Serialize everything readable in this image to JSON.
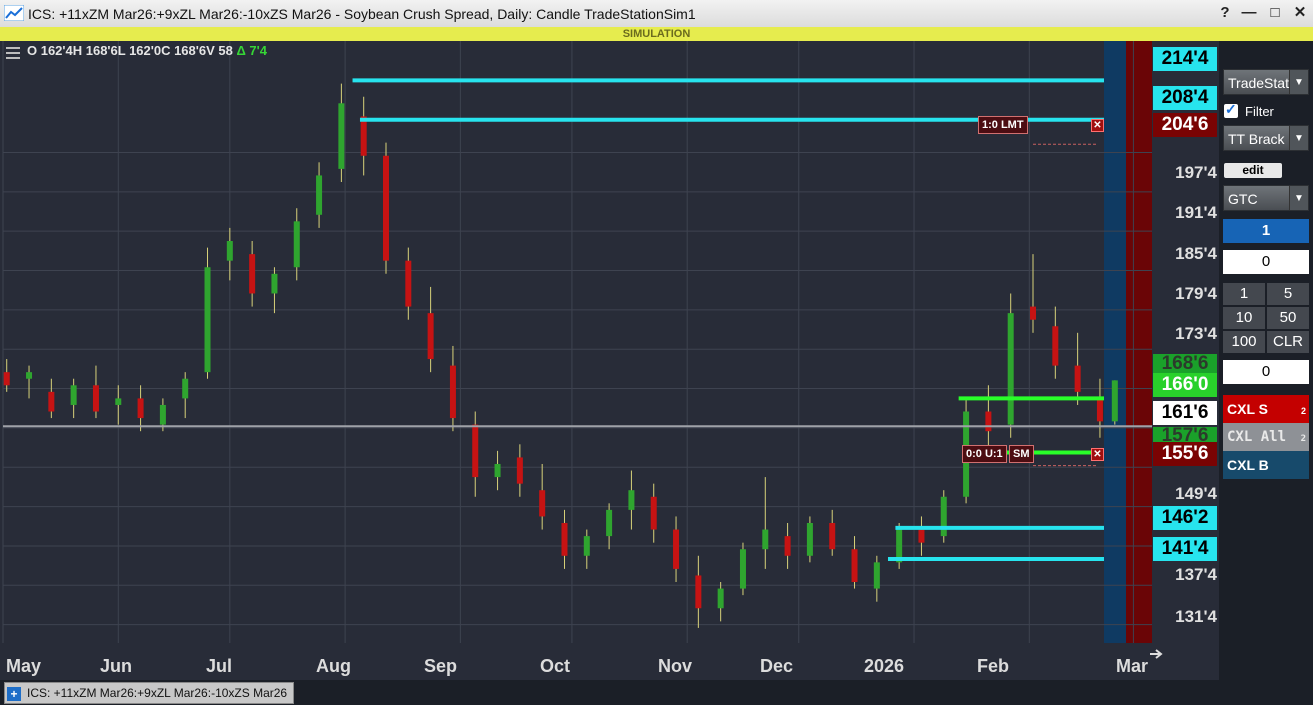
{
  "window": {
    "title": "ICS: +11xZM Mar26:+9xZL Mar26:-10xZS Mar26 - Soybean Crush Spread, Daily: Candle TradeStationSim1",
    "controls": [
      "?",
      "—",
      "□",
      "✕"
    ]
  },
  "mode_banner": "SIMULATION",
  "ohlc": {
    "text": "O 162'4H 168'6L 162'0C 168'6V 58",
    "change": "Δ 7'4"
  },
  "y_axis_labels": [
    "197'4",
    "191'4",
    "185'4",
    "179'4",
    "173'4",
    "149'4",
    "137'4",
    "131'4"
  ],
  "price_labels": {
    "cyan_top": "214'4",
    "cyan_second": "208'4",
    "limit_order": "204'6",
    "last_green_dim": "168'6",
    "green_line": "166'0",
    "current": "161'6",
    "green_low_dim": "157'6",
    "stop_order": "155'6",
    "cyan_third": "146'2",
    "cyan_bottom": "141'4"
  },
  "order_tags": {
    "limit": "1:0 LMT",
    "stop_count": "0:0 U:1",
    "stop_type": "SM",
    "cancel_glyph": "✕"
  },
  "x_axis_labels": [
    "May",
    "Jun",
    "Jul",
    "Aug",
    "Sep",
    "Oct",
    "Nov",
    "Dec",
    "2026",
    "Feb",
    "Mar"
  ],
  "footer_tab": {
    "plus": "+",
    "label": "ICS: +11xZM Mar26:+9xZL Mar26:-10xZS Mar26"
  },
  "order_panel": {
    "account_dropdown": "TradeStat",
    "filter_label": "Filter",
    "bracket_dropdown": "TT Brack",
    "edit_label": "edit",
    "duration_dropdown": "GTC",
    "quantity_selected": "1",
    "quantity_input": "0",
    "quick_qty": [
      "1",
      "5",
      "10",
      "50",
      "100",
      "CLR"
    ],
    "position_value": "0",
    "cxl_sell": "CXL S",
    "cxl_sell_count": "2",
    "cxl_all": "CXL All",
    "cxl_all_count": "2",
    "cxl_buy": "CXL B"
  },
  "colors": {
    "bull_candle": "#2fa52f",
    "bear_candle": "#c61313",
    "cyan_line": "#27e4ee",
    "green_line": "#29ff29",
    "chart_bg": "#282c38"
  },
  "chart_data": {
    "type": "candlestick",
    "title": "Soybean Crush Spread, Daily",
    "y_ticks": [
      131.5,
      137.5,
      143.5,
      149.5,
      155.5,
      161.5,
      167.5,
      173.5,
      179.5,
      185.5,
      191.5,
      197.5,
      203.5
    ],
    "ylim": [
      128.7,
      220.5
    ],
    "x_start": "2025-05-01",
    "x_end": "2026-03-06",
    "horizontal_lines": [
      {
        "price": 214.5,
        "color": "cyan",
        "from": "2025-08-03"
      },
      {
        "price": 208.5,
        "color": "cyan",
        "from": "2025-08-05"
      },
      {
        "price": 166.0,
        "color": "green",
        "from": "2026-01-13"
      },
      {
        "price": 157.75,
        "color": "green",
        "from": "2026-01-14"
      },
      {
        "price": 146.25,
        "color": "cyan",
        "from": "2025-12-27"
      },
      {
        "price": 141.5,
        "color": "cyan",
        "from": "2025-12-25"
      },
      {
        "price": 161.75,
        "color": "current",
        "from": "2025-05-01"
      }
    ],
    "orders": [
      {
        "label": "1:0 LMT",
        "price": 204.75
      },
      {
        "label": "0:0 U:1 SM",
        "price": 155.75
      }
    ],
    "candles": [
      {
        "d": "2025-05-02",
        "o": 170,
        "h": 172,
        "l": 167,
        "c": 168
      },
      {
        "d": "2025-05-08",
        "o": 169,
        "h": 171,
        "l": 166,
        "c": 170
      },
      {
        "d": "2025-05-14",
        "o": 167,
        "h": 169,
        "l": 163,
        "c": 164
      },
      {
        "d": "2025-05-20",
        "o": 165,
        "h": 169,
        "l": 163,
        "c": 168
      },
      {
        "d": "2025-05-26",
        "o": 168,
        "h": 171,
        "l": 163,
        "c": 164
      },
      {
        "d": "2025-06-01",
        "o": 165,
        "h": 168,
        "l": 162,
        "c": 166
      },
      {
        "d": "2025-06-07",
        "o": 166,
        "h": 168,
        "l": 161,
        "c": 163
      },
      {
        "d": "2025-06-13",
        "o": 162,
        "h": 166,
        "l": 161,
        "c": 165
      },
      {
        "d": "2025-06-19",
        "o": 166,
        "h": 170,
        "l": 163,
        "c": 169
      },
      {
        "d": "2025-06-25",
        "o": 170,
        "h": 189,
        "l": 169,
        "c": 186
      },
      {
        "d": "2025-07-01",
        "o": 187,
        "h": 192,
        "l": 184,
        "c": 190
      },
      {
        "d": "2025-07-07",
        "o": 188,
        "h": 190,
        "l": 180,
        "c": 182
      },
      {
        "d": "2025-07-13",
        "o": 182,
        "h": 186,
        "l": 179,
        "c": 185
      },
      {
        "d": "2025-07-19",
        "o": 186,
        "h": 195,
        "l": 184,
        "c": 193
      },
      {
        "d": "2025-07-25",
        "o": 194,
        "h": 202,
        "l": 192,
        "c": 200
      },
      {
        "d": "2025-07-31",
        "o": 201,
        "h": 214,
        "l": 199,
        "c": 211
      },
      {
        "d": "2025-08-06",
        "o": 209,
        "h": 212,
        "l": 200,
        "c": 203
      },
      {
        "d": "2025-08-12",
        "o": 203,
        "h": 205,
        "l": 185,
        "c": 187
      },
      {
        "d": "2025-08-18",
        "o": 187,
        "h": 189,
        "l": 178,
        "c": 180
      },
      {
        "d": "2025-08-24",
        "o": 179,
        "h": 183,
        "l": 170,
        "c": 172
      },
      {
        "d": "2025-08-30",
        "o": 171,
        "h": 174,
        "l": 161,
        "c": 163
      },
      {
        "d": "2025-09-05",
        "o": 162,
        "h": 164,
        "l": 151,
        "c": 154
      },
      {
        "d": "2025-09-11",
        "o": 154,
        "h": 158,
        "l": 152,
        "c": 156
      },
      {
        "d": "2025-09-17",
        "o": 157,
        "h": 159,
        "l": 151,
        "c": 153
      },
      {
        "d": "2025-09-23",
        "o": 152,
        "h": 156,
        "l": 146,
        "c": 148
      },
      {
        "d": "2025-09-29",
        "o": 147,
        "h": 149,
        "l": 140,
        "c": 142
      },
      {
        "d": "2025-10-05",
        "o": 142,
        "h": 146,
        "l": 140,
        "c": 145
      },
      {
        "d": "2025-10-11",
        "o": 145,
        "h": 150,
        "l": 143,
        "c": 149
      },
      {
        "d": "2025-10-17",
        "o": 149,
        "h": 155,
        "l": 146,
        "c": 152
      },
      {
        "d": "2025-10-23",
        "o": 151,
        "h": 153,
        "l": 144,
        "c": 146
      },
      {
        "d": "2025-10-29",
        "o": 146,
        "h": 148,
        "l": 138,
        "c": 140
      },
      {
        "d": "2025-11-04",
        "o": 139,
        "h": 142,
        "l": 131,
        "c": 134
      },
      {
        "d": "2025-11-10",
        "o": 134,
        "h": 138,
        "l": 132,
        "c": 137
      },
      {
        "d": "2025-11-16",
        "o": 137,
        "h": 144,
        "l": 136,
        "c": 143
      },
      {
        "d": "2025-11-22",
        "o": 143,
        "h": 154,
        "l": 140,
        "c": 146
      },
      {
        "d": "2025-11-28",
        "o": 145,
        "h": 147,
        "l": 140,
        "c": 142
      },
      {
        "d": "2025-12-04",
        "o": 142,
        "h": 148,
        "l": 141,
        "c": 147
      },
      {
        "d": "2025-12-10",
        "o": 147,
        "h": 149,
        "l": 142,
        "c": 143
      },
      {
        "d": "2025-12-16",
        "o": 143,
        "h": 145,
        "l": 137,
        "c": 138
      },
      {
        "d": "2025-12-22",
        "o": 137,
        "h": 142,
        "l": 135,
        "c": 141
      },
      {
        "d": "2025-12-28",
        "o": 141,
        "h": 147,
        "l": 140,
        "c": 146
      },
      {
        "d": "2026-01-03",
        "o": 146,
        "h": 148,
        "l": 142,
        "c": 144
      },
      {
        "d": "2026-01-09",
        "o": 145,
        "h": 152,
        "l": 144,
        "c": 151
      },
      {
        "d": "2026-01-15",
        "o": 151,
        "h": 166,
        "l": 150,
        "c": 164
      },
      {
        "d": "2026-01-21",
        "o": 164,
        "h": 168,
        "l": 158,
        "c": 161
      },
      {
        "d": "2026-01-27",
        "o": 162,
        "h": 182,
        "l": 160,
        "c": 179
      },
      {
        "d": "2026-02-02",
        "o": 180,
        "h": 188,
        "l": 176,
        "c": 178
      },
      {
        "d": "2026-02-08",
        "o": 177,
        "h": 180,
        "l": 169,
        "c": 171
      },
      {
        "d": "2026-02-14",
        "o": 171,
        "h": 176,
        "l": 165,
        "c": 167
      },
      {
        "d": "2026-02-20",
        "o": 166,
        "h": 169,
        "l": 160,
        "c": 162.5
      },
      {
        "d": "2026-02-24",
        "o": 162.5,
        "h": 168.75,
        "l": 162,
        "c": 168.75
      }
    ]
  }
}
